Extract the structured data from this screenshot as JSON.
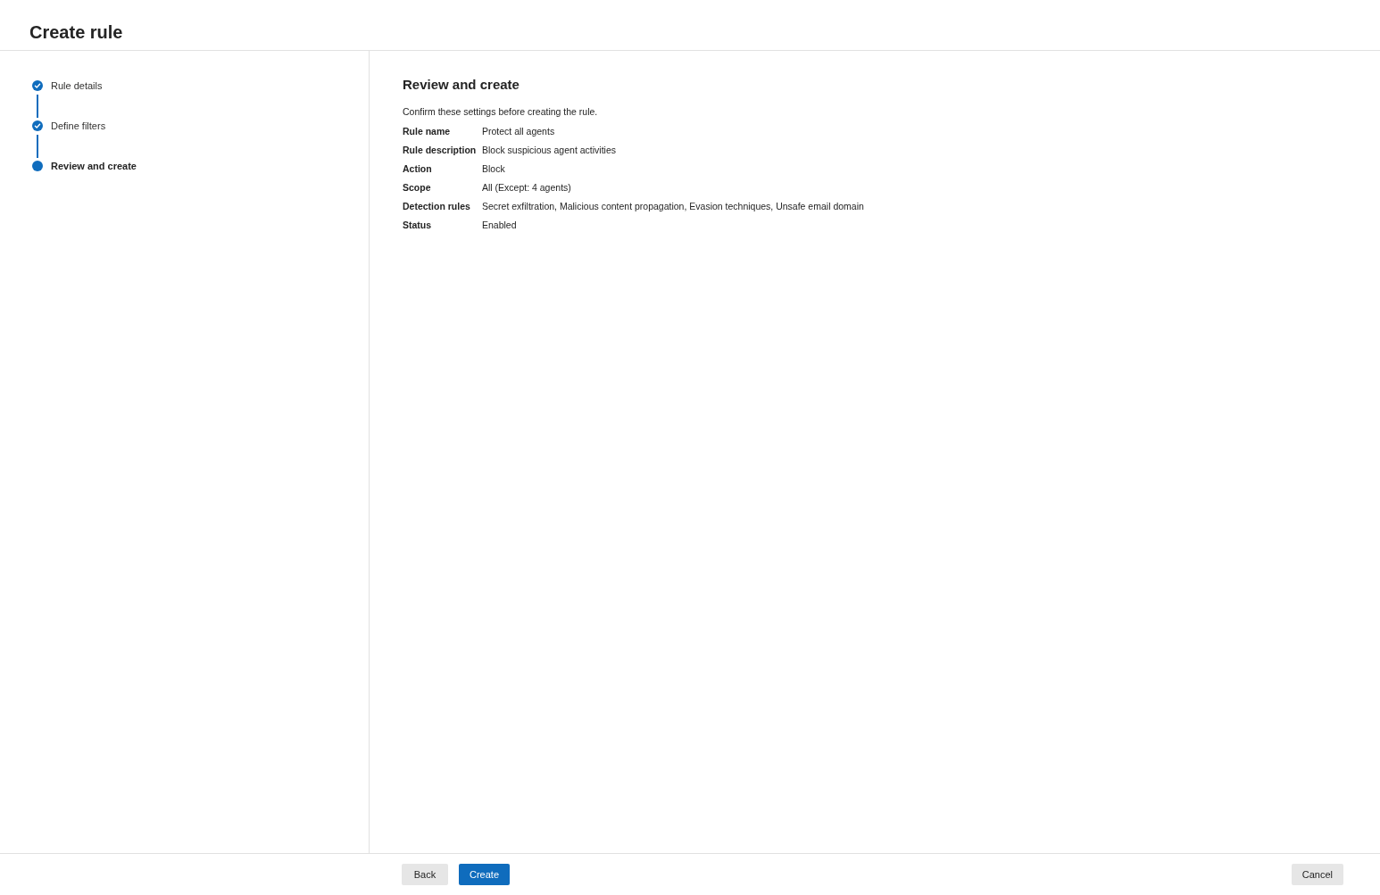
{
  "header": {
    "title": "Create rule"
  },
  "steps": [
    {
      "label": "Rule details",
      "completed": true,
      "selected": false
    },
    {
      "label": "Define filters",
      "completed": true,
      "selected": false
    },
    {
      "label": "Review and create",
      "completed": false,
      "selected": true
    }
  ],
  "review": {
    "heading": "Review and create",
    "description": "Confirm these settings before creating the rule.",
    "fields": [
      {
        "label": "Rule name",
        "value": "Protect all agents"
      },
      {
        "label": "Rule description",
        "value": "Block suspicious agent activities"
      },
      {
        "label": "Action",
        "value": "Block"
      },
      {
        "label": "Scope",
        "value": "All (Except: 4 agents)"
      },
      {
        "label": "Detection rules",
        "value": "Secret exfiltration, Malicious content propagation, Evasion techniques, Unsafe email domain"
      },
      {
        "label": "Status",
        "value": "Enabled"
      }
    ]
  },
  "footer": {
    "left_buttons": [
      {
        "label": "Back",
        "kind": "secondary"
      },
      {
        "label": "Create",
        "kind": "primary"
      }
    ],
    "right_buttons": [
      {
        "label": "Cancel",
        "kind": "secondary"
      }
    ]
  }
}
